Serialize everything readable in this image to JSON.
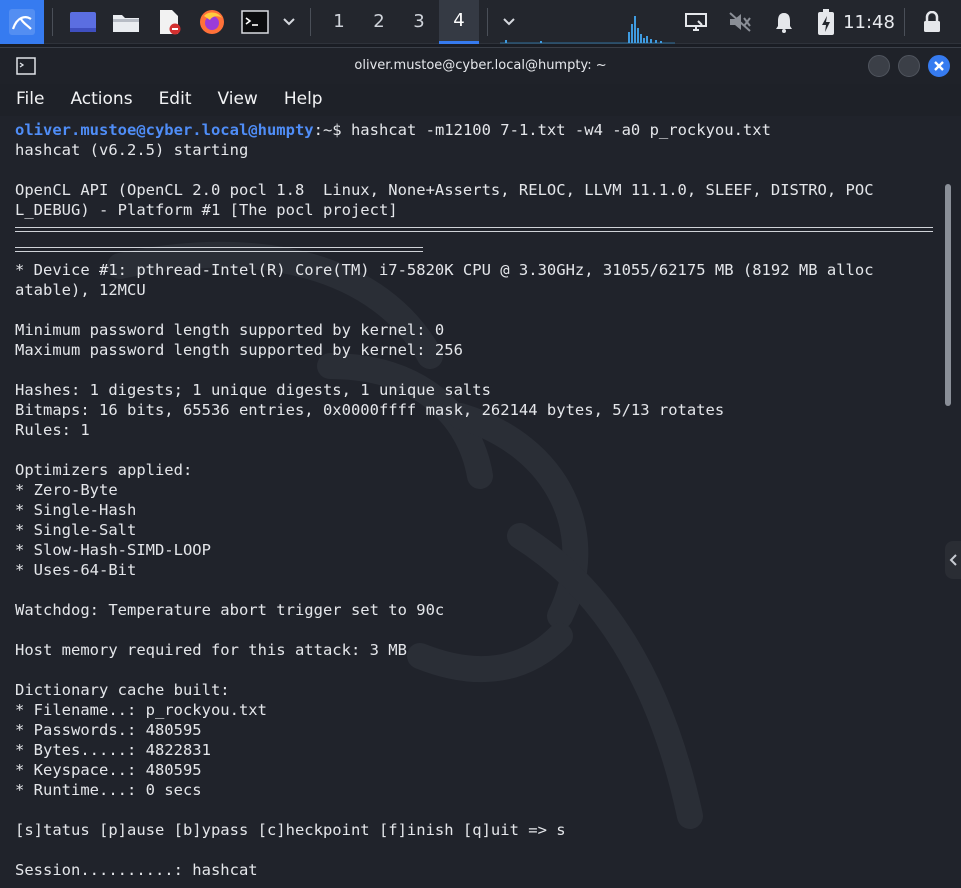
{
  "panel": {
    "workspaces": [
      "1",
      "2",
      "3",
      "4"
    ],
    "active_workspace": "4",
    "clock": "11:48",
    "accent": "#367bf0",
    "launcher_icons": [
      "kali-menu-icon",
      "desktop-icon",
      "file-manager-icon",
      "text-editor-icon",
      "firefox-icon",
      "terminal-icon",
      "chevron-down-icon"
    ]
  },
  "window": {
    "title": "oliver.mustoe@cyber.local@humpty: ~",
    "menu": [
      "File",
      "Actions",
      "Edit",
      "View",
      "Help"
    ]
  },
  "terminal": {
    "prompt_user": "oliver.mustoe@cyber.local@humpty",
    "prompt_path": ":~",
    "prompt_symbol": "$ ",
    "command": "hashcat -m12100 7-1.txt -w4 -a0 p_rockyou.txt",
    "lines_a": [
      "hashcat (v6.2.5) starting",
      "",
      "OpenCL API (OpenCL 2.0 pocl 1.8  Linux, None+Asserts, RELOC, LLVM 11.1.0, SLEEF, DISTRO, POC",
      "L_DEBUG) - Platform #1 [The pocl project]"
    ],
    "lines_b": [
      "* Device #1: pthread-Intel(R) Core(TM) i7-5820K CPU @ 3.30GHz, 31055/62175 MB (8192 MB alloc",
      "atable), 12MCU",
      "",
      "Minimum password length supported by kernel: 0",
      "Maximum password length supported by kernel: 256",
      "",
      "Hashes: 1 digests; 1 unique digests, 1 unique salts",
      "Bitmaps: 16 bits, 65536 entries, 0x0000ffff mask, 262144 bytes, 5/13 rotates",
      "Rules: 1",
      "",
      "Optimizers applied:",
      "* Zero-Byte",
      "* Single-Hash",
      "* Single-Salt",
      "* Slow-Hash-SIMD-LOOP",
      "* Uses-64-Bit",
      "",
      "Watchdog: Temperature abort trigger set to 90c",
      "",
      "Host memory required for this attack: 3 MB",
      "",
      "Dictionary cache built:",
      "* Filename..: p_rockyou.txt",
      "* Passwords.: 480595",
      "* Bytes.....: 4822831",
      "* Keyspace..: 480595",
      "* Runtime...: 0 secs",
      "",
      "[s]tatus [p]ause [b]ypass [c]heckpoint [f]inish [q]uit => s",
      "",
      "Session..........: hashcat"
    ]
  }
}
